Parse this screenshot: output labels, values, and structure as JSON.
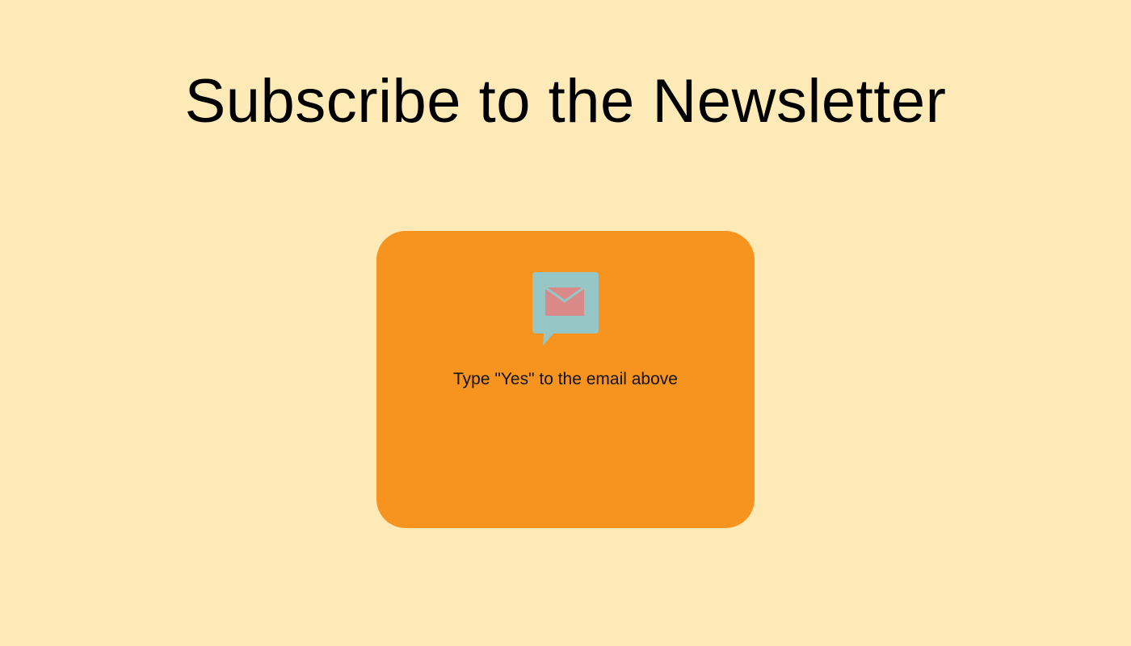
{
  "page": {
    "title": "Subscribe to the Newsletter",
    "background_color": "#FEEAB6"
  },
  "card": {
    "background_color": "#F7941F",
    "icon": "mail-chat-bubble-icon",
    "icon_colors": {
      "bubble": "#96C7C6",
      "envelope": "#D98A88"
    },
    "instruction": "Type \"Yes\" to the email above"
  }
}
